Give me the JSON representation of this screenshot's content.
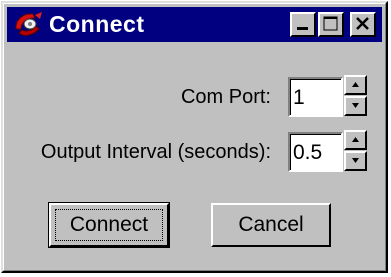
{
  "window": {
    "title": "Connect",
    "icon": "serial-connect-icon"
  },
  "caption_buttons": [
    "minimize-icon",
    "maximize-icon",
    "close-icon"
  ],
  "form": {
    "com_port_label": "Com Port:",
    "com_port_value": "1",
    "interval_label": "Output Interval (seconds):",
    "interval_value": "0.5"
  },
  "buttons": {
    "connect": "Connect",
    "cancel": "Cancel"
  },
  "colors": {
    "titlebar": "#000080",
    "face": "#c0c0c0"
  }
}
